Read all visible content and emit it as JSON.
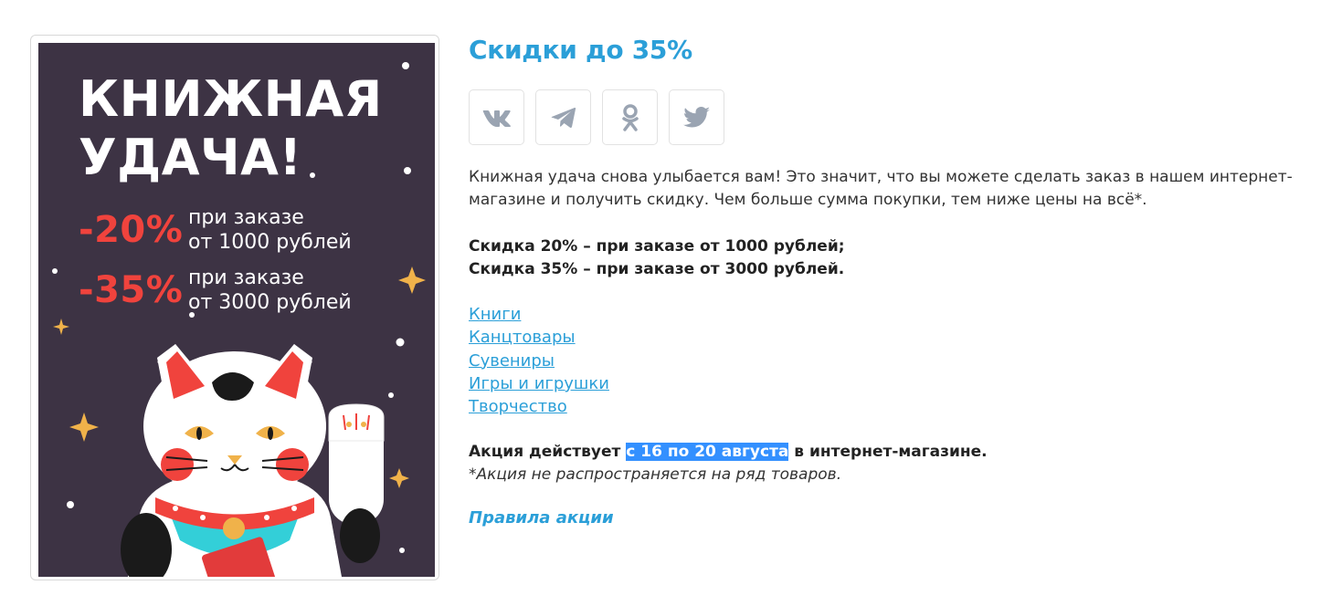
{
  "banner": {
    "title_line1": "КНИЖНАЯ",
    "title_line2": "УДАЧА!",
    "offers": [
      {
        "percent": "-20%",
        "text": "при заказе\nот 1000 рублей"
      },
      {
        "percent": "-35%",
        "text": "при заказе\nот 3000 рублей"
      }
    ],
    "colors": {
      "background": "#3d3344",
      "accent": "#f0433d",
      "text": "#ffffff"
    }
  },
  "promo": {
    "title": "Скидки до 35%",
    "share": [
      {
        "name": "vk",
        "icon": "vk-icon"
      },
      {
        "name": "telegram",
        "icon": "telegram-icon"
      },
      {
        "name": "odnoklassniki",
        "icon": "odnoklassniki-icon"
      },
      {
        "name": "twitter",
        "icon": "twitter-icon"
      }
    ],
    "description": "Книжная удача снова улыбается вам! Это значит, что вы можете сделать заказ в нашем интернет-магазине и получить скидку. Чем больше сумма покупки, тем ниже цены на всё*.",
    "conditions": [
      "Скидка 20% – при заказе от 1000 рублей;",
      "Скидка 35% – при заказе от 3000 рублей."
    ],
    "categories": [
      "Книги",
      "Канцтовары",
      "Сувениры",
      "Игры и игрушки",
      "Творчество"
    ],
    "period": {
      "prefix": "Акция действует ",
      "highlight": "с 16 по 20 августа",
      "suffix": " в интернет-магазине."
    },
    "note": "*Акция не распространяется на ряд товаров.",
    "rules_link": "Правила акции"
  },
  "colors": {
    "accent": "#2b9fd8",
    "highlight": "#3390ff",
    "icon_gray": "#9aa4b2"
  }
}
